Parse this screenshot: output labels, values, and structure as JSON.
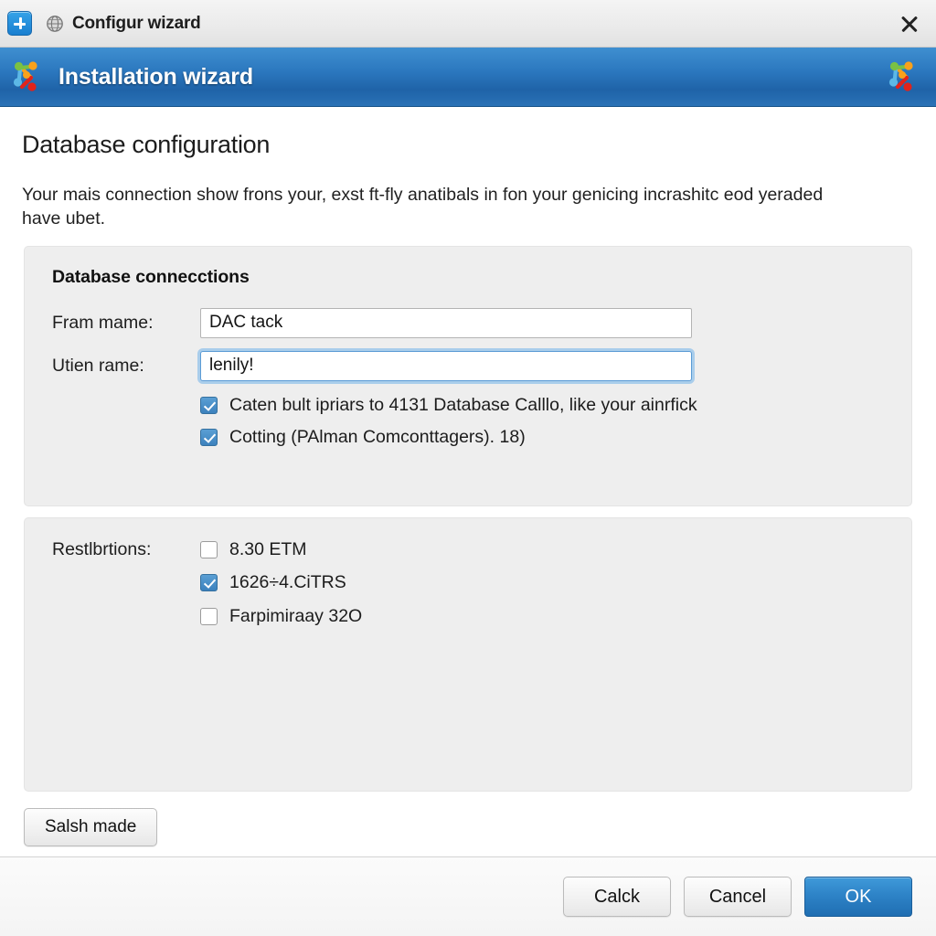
{
  "tabbar": {
    "new_tab_label": "+",
    "tab_icon": "globe-icon",
    "tab_title": "Configur wizard",
    "close_label": "×"
  },
  "banner": {
    "title": "Installation wizard",
    "left_logo": "joomla-logo",
    "right_logo": "joomla-logo"
  },
  "page": {
    "title": "Database configuration",
    "description": "Your mais connection show frons your, exst ft-fly anatibals in fon your genicing incrashitc eod yeraded have ubet."
  },
  "group_one": {
    "heading": "Database connecctions",
    "fields": [
      {
        "label": "Fram mame:",
        "value": "DAC tack",
        "placeholder": "",
        "focused": false
      },
      {
        "label": "Utien rame:",
        "value": "lenily!",
        "placeholder": "",
        "focused": true
      }
    ],
    "checkboxes": [
      {
        "label": "Caten bult ipriars to 4131 Database Calllo, like your ainrfick",
        "checked": true
      },
      {
        "label": "Cotting (PAlman Comconttagers). 18)",
        "checked": true
      }
    ]
  },
  "group_two": {
    "label": "Restlbrtions:",
    "checkboxes": [
      {
        "label": "8.30 ETM",
        "checked": false
      },
      {
        "label": "1626÷4.CiTRS",
        "checked": true
      },
      {
        "label": "Farpimiraay 32O",
        "checked": false
      }
    ]
  },
  "actions": {
    "secondary_left": "Salsh made"
  },
  "footer": {
    "buttons": [
      {
        "label": "Calck",
        "primary": false
      },
      {
        "label": "Cancel",
        "primary": false
      },
      {
        "label": "OK",
        "primary": true
      }
    ]
  },
  "colors": {
    "banner_blue": "#2b77be",
    "accent_blue": "#2d82c6",
    "checkbox_blue": "#3c81bd",
    "focus_ring": "#a9cdeb",
    "panel_gray": "#eeeeee"
  }
}
